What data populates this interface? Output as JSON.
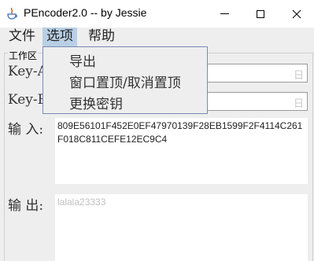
{
  "window": {
    "title": "PEncoder2.0 -- by Jessie",
    "minimize": "—",
    "maximize": "□",
    "close": "✕"
  },
  "menubar": {
    "file": "文件",
    "options": "选项",
    "help": "帮助"
  },
  "options_menu": {
    "items": [
      "导出",
      "窗口置顶/取消置顶",
      "更换密钥"
    ]
  },
  "workspace": {
    "title": "工作区",
    "key1_label": "Key-A",
    "key2_label": "Key-B",
    "key_placeholder": "日",
    "input_label": "输 入:",
    "input_text": "809E56101F452E0EF47970139F28EB1599F2F4114C261F018C811CEFE12EC9C4",
    "output_label": "输 出:",
    "output_text": "lalala23333"
  }
}
